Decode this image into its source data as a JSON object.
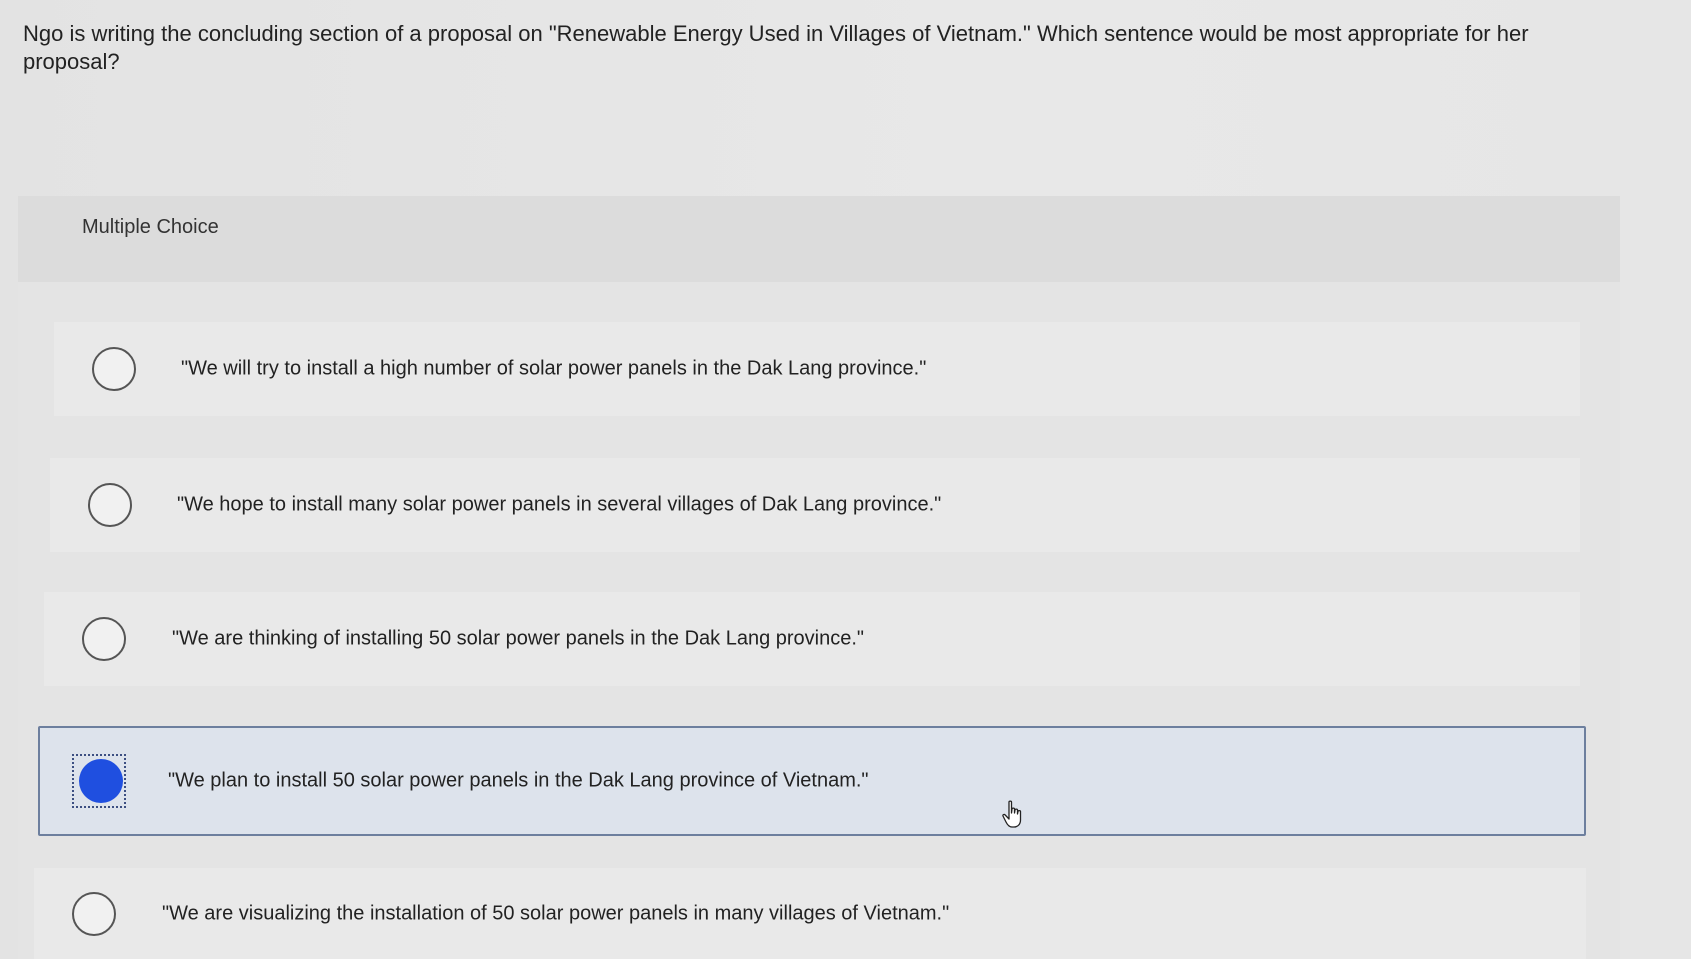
{
  "question": {
    "text": "Ngo is writing the concluding section of a proposal on \"Renewable Energy Used in Villages of Vietnam.\" Which sentence would be most appropriate for her proposal?"
  },
  "multiple_choice": {
    "title": "Multiple Choice",
    "selected_index": 3,
    "choices": [
      {
        "label": "\"We will try to install a high number of solar power panels in the Dak Lang province.\""
      },
      {
        "label": "\"We hope to install many solar power panels in several villages of Dak Lang province.\""
      },
      {
        "label": "\"We are thinking of installing 50 solar power panels in the Dak Lang province.\""
      },
      {
        "label": "\"We plan to install 50 solar power panels in the Dak Lang province of Vietnam.\""
      },
      {
        "label": "\"We are visualizing the installation of 50 solar power panels in many villages of Vietnam.\""
      }
    ]
  },
  "colors": {
    "selected_fill": "#1f4fe0",
    "selected_border": "#6d7f9e",
    "selected_background": "#dde3ec"
  },
  "icons": {
    "cursor": "hand-pointer-icon"
  }
}
